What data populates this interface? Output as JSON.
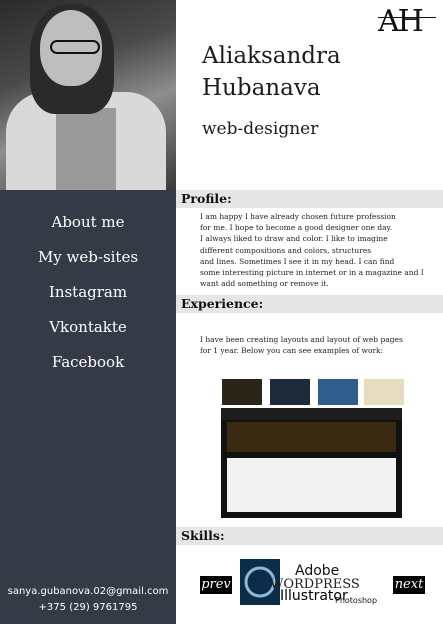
{
  "profile": {
    "name_line1": "Aliaksandra",
    "name_line2": "Hubanava",
    "role": "web-designer"
  },
  "logo": {
    "text": "AH"
  },
  "nav": {
    "items": [
      {
        "label": "About me"
      },
      {
        "label": "My web-sites"
      },
      {
        "label": "Instagram"
      },
      {
        "label": "Vkontakte"
      },
      {
        "label": "Facebook"
      }
    ]
  },
  "contacts": {
    "email": "sanya.gubanova.02@gmail.com",
    "phone": "+375 (29) 9761795"
  },
  "sections": {
    "profile_title": "Profile:",
    "profile_lines": [
      "I am happy I have already chosen future profession",
      "for me. I hope to become a good designer one day.",
      "I always liked to draw and color. I like to imagine",
      "different compositions and colors, structures",
      "and lines. Sometimes I see it in my head. I can find",
      "some interesting picture in internet or in a magazine and I",
      "want add something or remove it."
    ],
    "experience_title": "Experience:",
    "experience_lines": [
      "I have been creating layouts and layout of web pages",
      "for 1 year. Below you can see examples of work:"
    ],
    "skills_title": "Skills:"
  },
  "skills": {
    "prev_label": "prev",
    "next_label": "next",
    "logo_items": [
      "Adobe",
      "WORDPRESS",
      "Illustrator",
      "Photoshop"
    ]
  }
}
